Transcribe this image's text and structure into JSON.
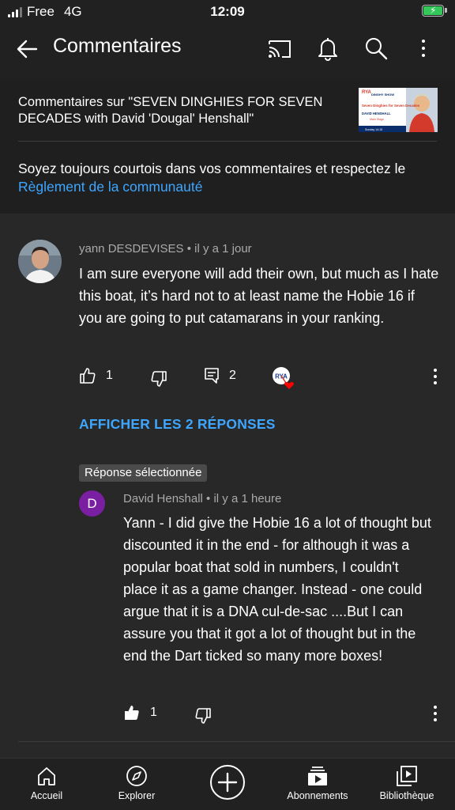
{
  "status_bar": {
    "carrier": "Free",
    "network": "4G",
    "time": "12:09"
  },
  "app_bar": {
    "title": "Commentaires"
  },
  "video": {
    "caption": "Commentaires sur \"SEVEN DINGHIES FOR SEVEN DECADES with David 'Dougal' Henshall\"",
    "thumbnail": {
      "brand": "RYA",
      "show": "DINGHY SHOW",
      "title": "Seven Dinghies for Seven Decades",
      "speaker": "DAVID HENSHALL",
      "stage": "Main Stage",
      "day": "Sunday 14:15"
    }
  },
  "guidelines": {
    "text": "Soyez toujours courtois dans vos commentaires et respectez le ",
    "link": "Règlement de la communauté"
  },
  "comments": [
    {
      "author": "yann DESDEVISES",
      "time": " • il y a 1 jour",
      "text": "I am sure everyone will add their own, but much as I hate this boat, it’s hard not to at least name the Hobie 16 if you are going to put catamarans in your ranking.",
      "likes": "1",
      "replies": "2",
      "heart_badge": "RYA"
    }
  ],
  "show_replies": "AFFICHER LES 2 RÉPONSES",
  "reply": {
    "badge": "Réponse sélectionnée",
    "avatar_letter": "D",
    "author": "David Henshall",
    "time": " • il y a 1 heure",
    "text": "Yann - I did give the Hobie 16 a lot of thought but discounted it  in the end - for although it was a popular boat that sold in numbers, I couldn't place it as a game changer. Instead - one could argue that it is a DNA cul-de-sac ....But I can assure you that it got a lot of thought but in the end the Dart ticked so many more boxes!",
    "likes": "1"
  },
  "bottom_nav": [
    {
      "label": "Accueil",
      "icon": "home-icon"
    },
    {
      "label": "Explorer",
      "icon": "compass-icon"
    },
    {
      "label": "",
      "icon": "create-plus-icon"
    },
    {
      "label": "Abonnements",
      "icon": "subscriptions-icon"
    },
    {
      "label": "Bibliothèque",
      "icon": "library-icon"
    }
  ],
  "colors": {
    "background": "#282828",
    "bar": "#212121",
    "link": "#3ea6ff",
    "reply_avatar": "#7b1fa2",
    "battery": "#34c759"
  }
}
